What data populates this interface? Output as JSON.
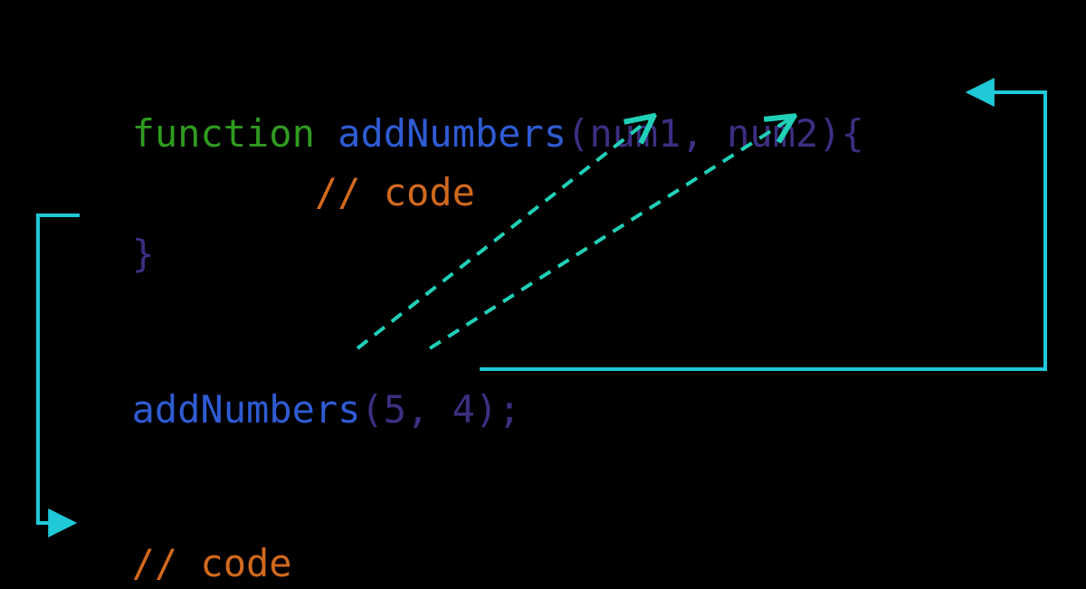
{
  "colors": {
    "keyword": "#2f9b1f",
    "identifier": "#2f5bd3",
    "punctuation": "#3c2f82",
    "comment": "#d2691e",
    "arrow_solid": "#1fc9d8",
    "arrow_dashed": "#20d0b8"
  },
  "line1": {
    "kw": "function ",
    "fn": "addNumbers",
    "open": "(",
    "p1": "num1",
    "comma": ", ",
    "p2": "num2",
    "close": ")",
    "brace": "{"
  },
  "line2": {
    "indent": "        ",
    "comment": "// code"
  },
  "line3": {
    "brace": "}"
  },
  "line5": {
    "fn": "addNumbers",
    "open": "(",
    "a1": "5",
    "comma": ", ",
    "a2": "4",
    "close": ")",
    "semi": ";"
  },
  "line7": {
    "comment": "// code"
  }
}
